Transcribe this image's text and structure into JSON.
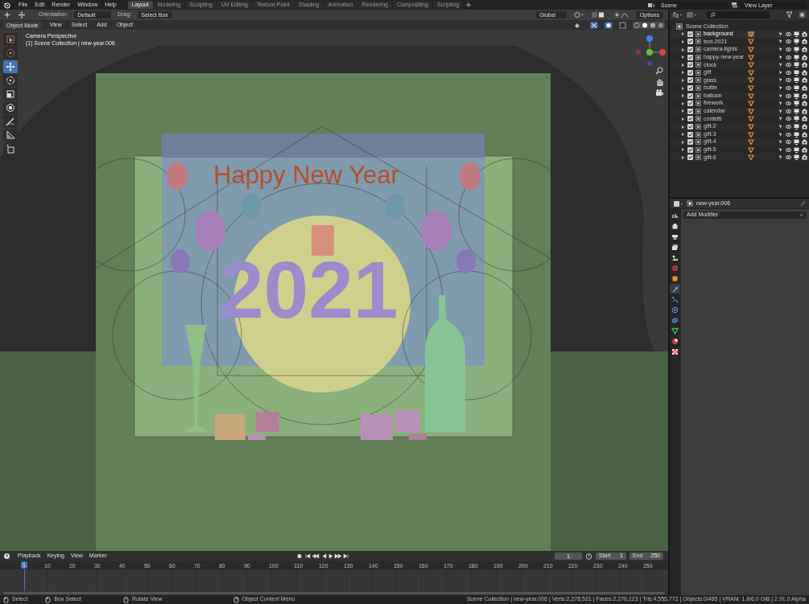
{
  "menubar": {
    "menus": [
      "File",
      "Edit",
      "Render",
      "Window",
      "Help"
    ],
    "workspaces": [
      {
        "label": "Layout",
        "selected": true
      },
      {
        "label": "Modeling",
        "selected": false
      },
      {
        "label": "Sculpting",
        "selected": false
      },
      {
        "label": "UV Editing",
        "selected": false
      },
      {
        "label": "Texture Paint",
        "selected": false
      },
      {
        "label": "Shading",
        "selected": false
      },
      {
        "label": "Animation",
        "selected": false
      },
      {
        "label": "Rendering",
        "selected": false
      },
      {
        "label": "Compositing",
        "selected": false
      },
      {
        "label": "Scripting",
        "selected": false
      }
    ],
    "scene": "Scene",
    "view_layer": "View Layer"
  },
  "tool_header": {
    "orientation_label": "Orientation:",
    "orientation": "Default",
    "drag_label": "Drag:",
    "drag": "Select Box",
    "transform_orientation": "Global",
    "options": "Options"
  },
  "viewport": {
    "mode": "Object Mode",
    "menus": [
      "View",
      "Select",
      "Add",
      "Object"
    ],
    "view_name": "Camera Perspective",
    "collection_info": "(1) Scene Collection | new-year.006",
    "tools": [
      {
        "kind": "select_box",
        "selected": false
      },
      {
        "kind": "cursor",
        "selected": false
      },
      {
        "kind": "move",
        "selected": true
      },
      {
        "kind": "rotate",
        "selected": false
      },
      {
        "kind": "scale",
        "selected": false
      },
      {
        "kind": "transform",
        "selected": false
      },
      {
        "kind": "annotate",
        "selected": false
      },
      {
        "kind": "measure",
        "selected": false
      },
      {
        "kind": "add_cube",
        "selected": false
      }
    ],
    "scene_title": "Happy New Year",
    "scene_year": "2021"
  },
  "outliner": {
    "root": "Scene Collection",
    "items": [
      {
        "name": "background",
        "checked": true,
        "selected": true
      },
      {
        "name": "text-2021",
        "checked": true,
        "selected": false
      },
      {
        "name": "camera-lights",
        "checked": true,
        "selected": false
      },
      {
        "name": "happy-new-year",
        "checked": true,
        "selected": false
      },
      {
        "name": "clock",
        "checked": true,
        "selected": false
      },
      {
        "name": "gift",
        "checked": true,
        "selected": false
      },
      {
        "name": "glass",
        "checked": true,
        "selected": false
      },
      {
        "name": "bottle",
        "checked": true,
        "selected": false
      },
      {
        "name": "balloon",
        "checked": true,
        "selected": false
      },
      {
        "name": "firework",
        "checked": true,
        "selected": false
      },
      {
        "name": "calendar",
        "checked": true,
        "selected": false
      },
      {
        "name": "confetti",
        "checked": true,
        "selected": false
      },
      {
        "name": "gift-2",
        "checked": true,
        "selected": false
      },
      {
        "name": "gift-3",
        "checked": true,
        "selected": false
      },
      {
        "name": "gift-4",
        "checked": true,
        "selected": false
      },
      {
        "name": "gift-5",
        "checked": true,
        "selected": false
      },
      {
        "name": "gift-6",
        "checked": true,
        "selected": false
      }
    ]
  },
  "properties": {
    "object": "new-year.006",
    "add_modifier": "Add Modifier",
    "tabs": [
      {
        "kind": "tool",
        "selected": false
      },
      {
        "kind": "render",
        "selected": false
      },
      {
        "kind": "output",
        "selected": false
      },
      {
        "kind": "view_layer",
        "selected": false
      },
      {
        "kind": "scene",
        "selected": false
      },
      {
        "kind": "world",
        "selected": false
      },
      {
        "kind": "object",
        "selected": false
      },
      {
        "kind": "modifier",
        "selected": true
      },
      {
        "kind": "particles",
        "selected": false
      },
      {
        "kind": "physics",
        "selected": false
      },
      {
        "kind": "constraints",
        "selected": false
      },
      {
        "kind": "data",
        "selected": false
      },
      {
        "kind": "material",
        "selected": false
      },
      {
        "kind": "texture",
        "selected": false
      }
    ]
  },
  "timeline": {
    "menus": [
      "Playback",
      "Keying",
      "View",
      "Marker"
    ],
    "current_frame": "1",
    "start_label": "Start",
    "start": "1",
    "end_label": "End",
    "end": "250",
    "ticks": [
      "1",
      "10",
      "20",
      "30",
      "40",
      "50",
      "60",
      "70",
      "80",
      "90",
      "100",
      "110",
      "120",
      "130",
      "140",
      "150",
      "160",
      "170",
      "180",
      "190",
      "200",
      "210",
      "220",
      "230",
      "240",
      "250"
    ]
  },
  "status_bar": {
    "hints": [
      {
        "kind": "left",
        "label": "Select"
      },
      {
        "kind": "box",
        "label": "Box Select"
      },
      {
        "kind": "middle",
        "label": "Rotate View"
      },
      {
        "kind": "right",
        "label": "Object Context Menu"
      }
    ],
    "stats": "Scene Collection | new-year.006 | Verts:2,278,521 | Faces:2,276,123 | Tris:4,555,772 | Objects:0/485 | VRAM: 1.8/6.0 GiB | 2.91.0 Alpha"
  }
}
